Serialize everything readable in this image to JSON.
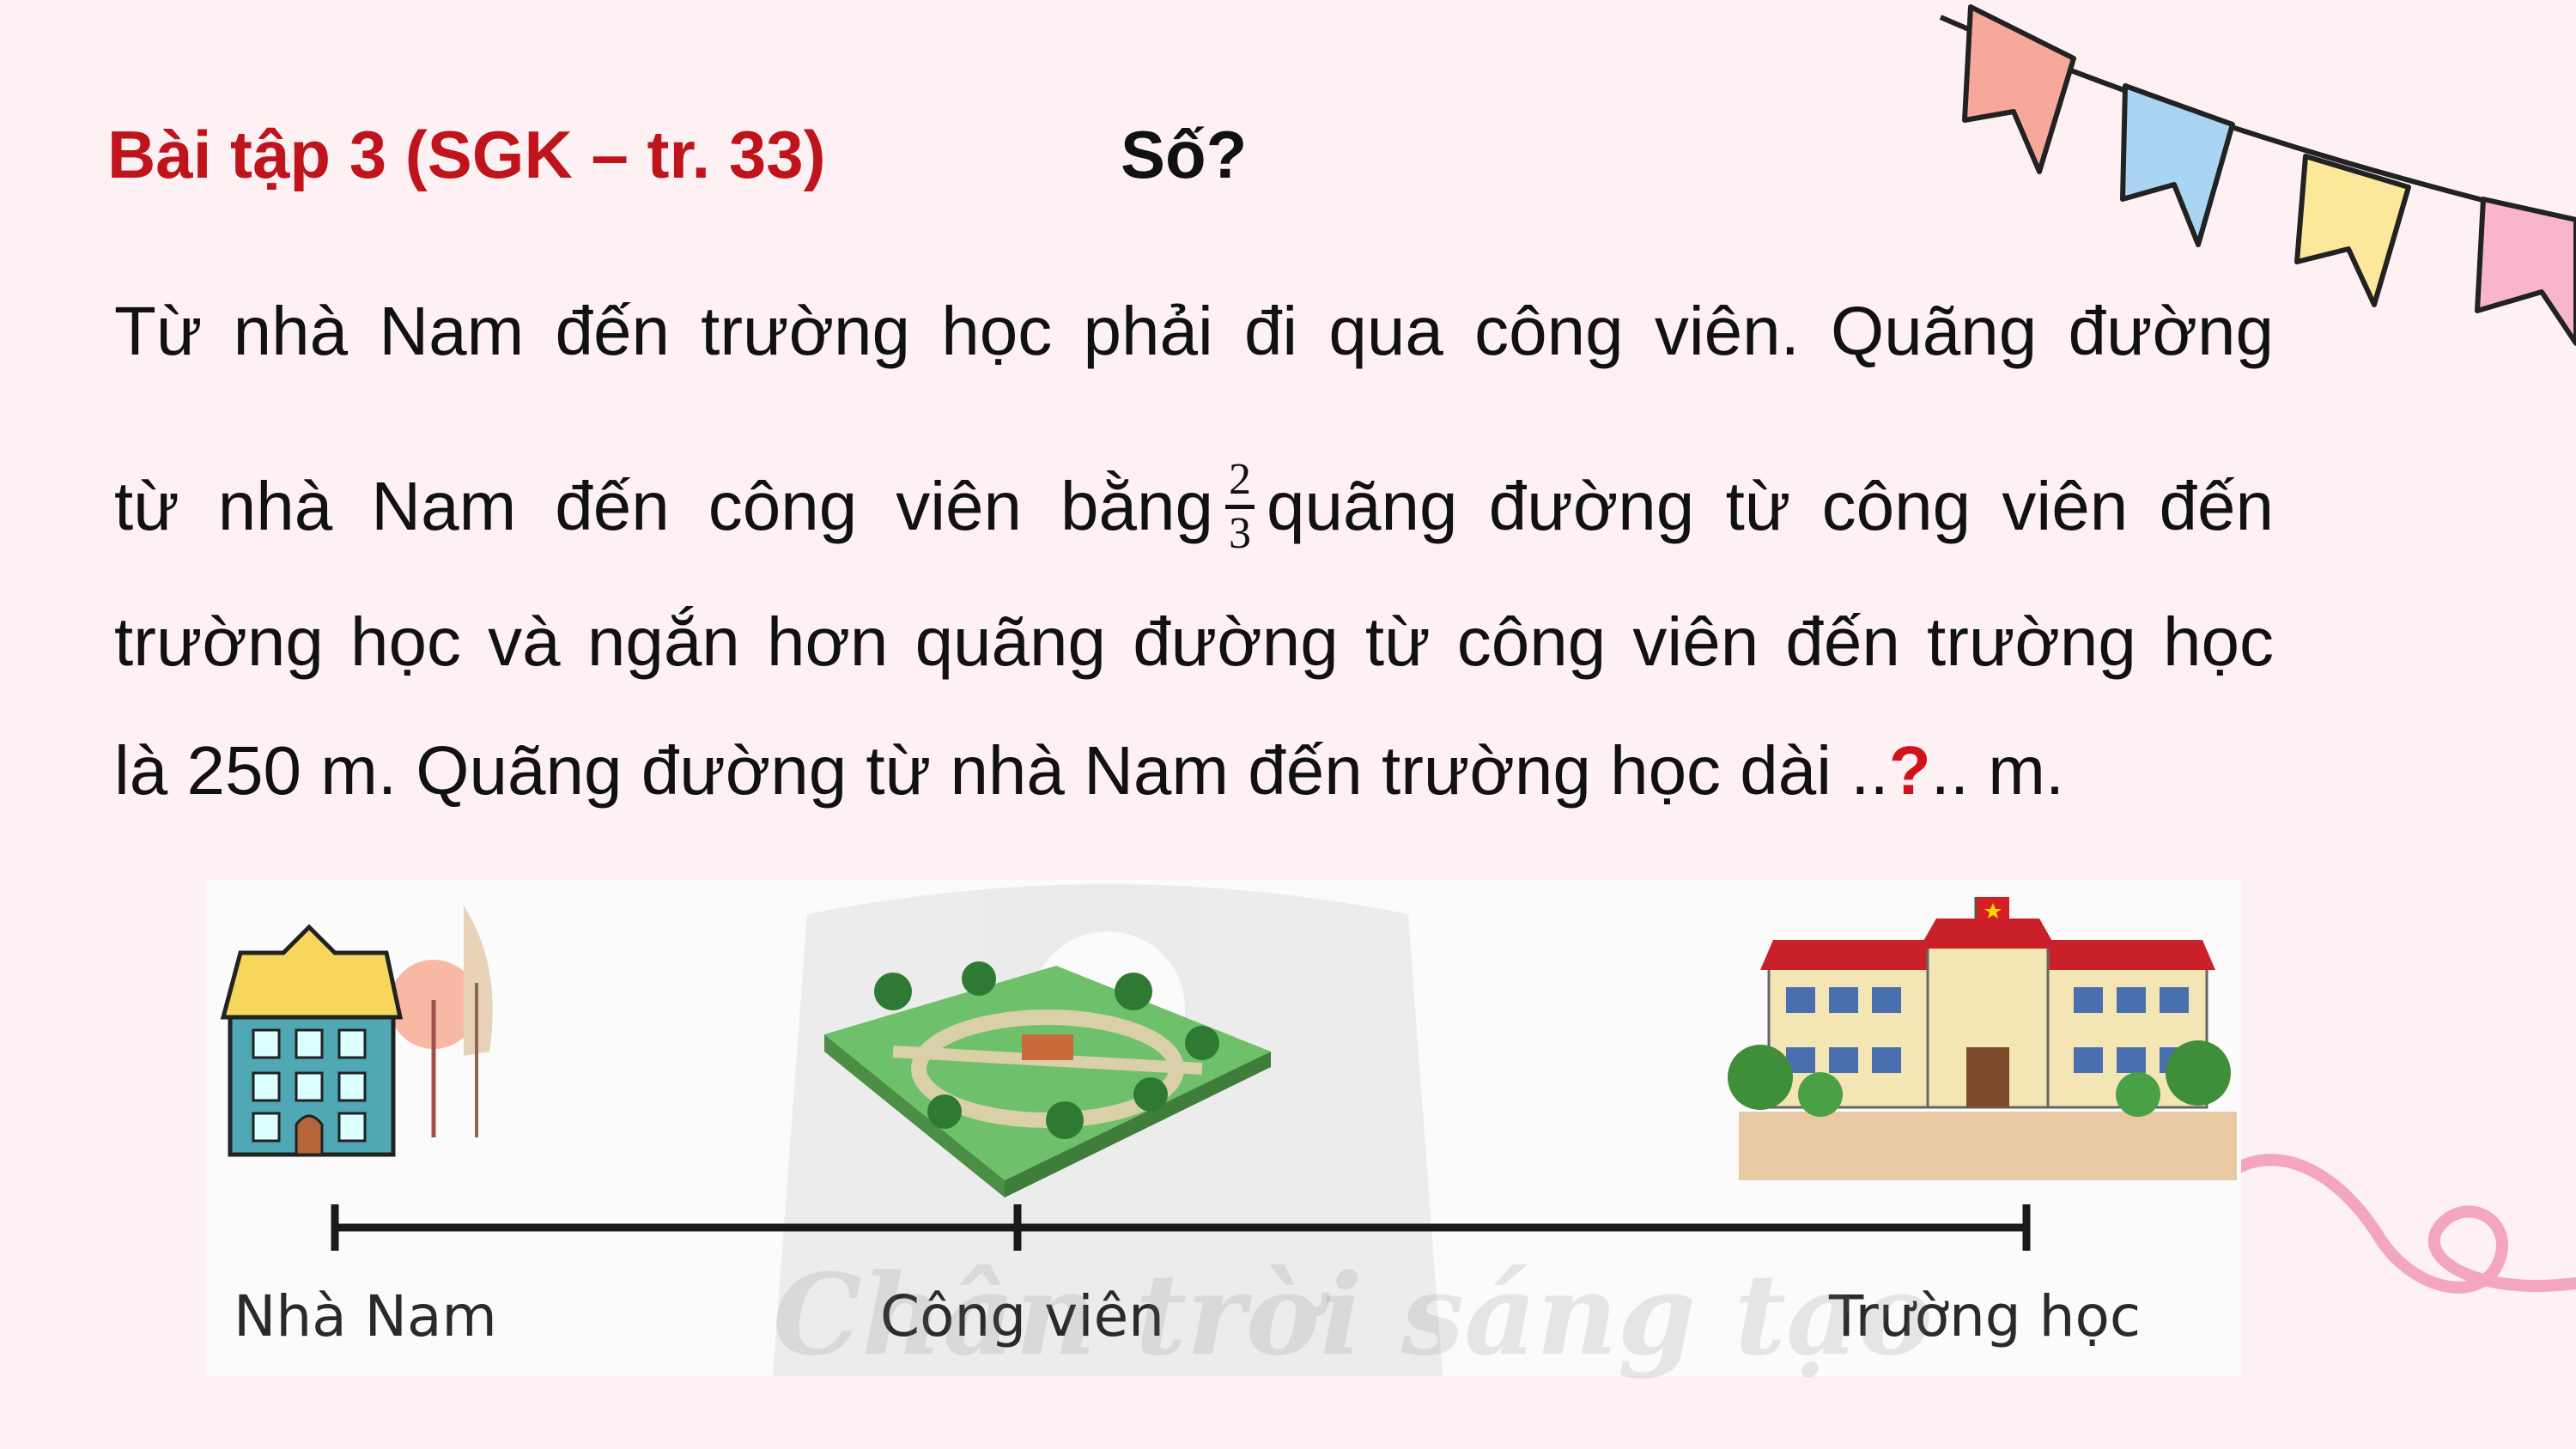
{
  "header": {
    "title": "Bài tập 3 (SGK – tr. 33)",
    "question": "Số?"
  },
  "problem": {
    "line1_words": [
      "Từ",
      "nhà",
      "Nam",
      "đến",
      "trường",
      "học",
      "phải",
      "đi",
      "qua",
      "công",
      "viên.",
      "Quãng",
      "đường"
    ],
    "line2_before_fraction": [
      "từ",
      "nhà",
      "Nam",
      "đến",
      "công",
      "viên",
      "bằng"
    ],
    "fraction": {
      "numerator": "2",
      "denominator": "3"
    },
    "line2_after_fraction": [
      "quãng",
      "đường",
      "từ",
      "công",
      "viên",
      "đến"
    ],
    "line3_words": [
      "trường",
      "học",
      "và",
      "ngắn",
      "hơn",
      "quãng",
      "đường",
      "từ",
      "công",
      "viên",
      "đến",
      "trường",
      "học"
    ],
    "line4_start": "là 250 m. Quãng đường từ nhà Nam đến trường học dài ..",
    "line4_unknown": "?",
    "line4_end": ".. m."
  },
  "illustration": {
    "labels": {
      "home": "Nhà Nam",
      "park": "Công viên",
      "school": "Trường học"
    },
    "watermark": "Chân trời sáng tạo"
  },
  "colors": {
    "background": "#fdf1f3",
    "title": "#c0141c",
    "unknown_mark": "#d0141c",
    "flag_1": "#f6a99a",
    "flag_2": "#a9d4f2",
    "flag_3": "#fbe89a",
    "flag_4": "#f8b5cc",
    "ribbon": "#f3a6bd"
  }
}
